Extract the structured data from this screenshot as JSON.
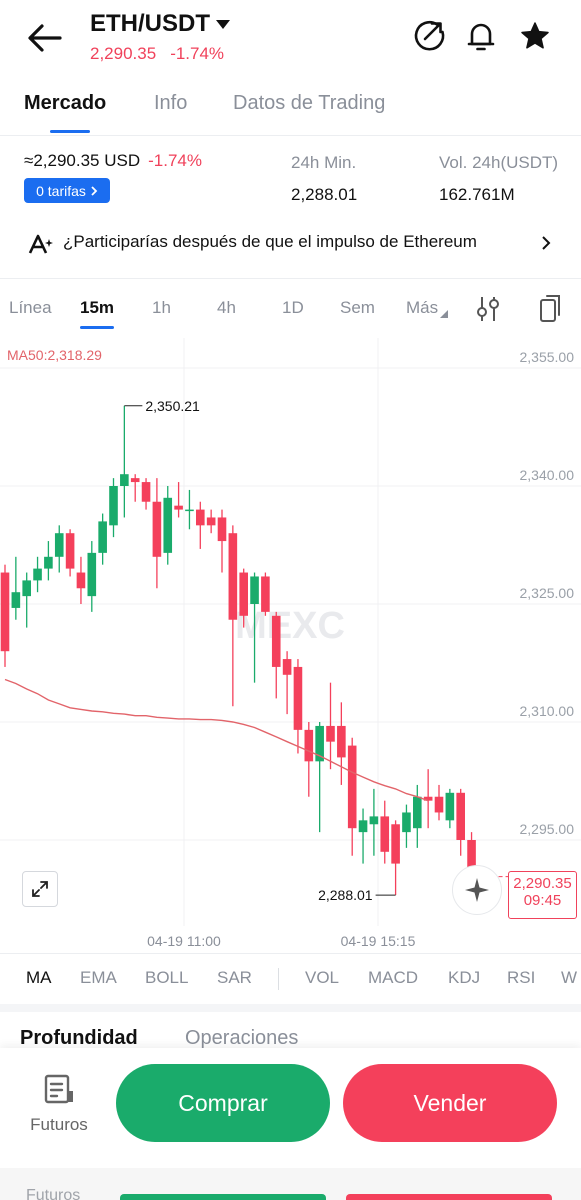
{
  "header": {
    "pair": "ETH/USDT",
    "price": "2,290.35",
    "change": "-1.74%"
  },
  "tabs": [
    {
      "label": "Mercado",
      "active": true
    },
    {
      "label": "Info",
      "active": false
    },
    {
      "label": "Datos de Trading",
      "active": false
    }
  ],
  "stats": {
    "approx_price": "≈2,290.35 USD",
    "change": "-1.74%",
    "fee_label": "0 tarifas",
    "low_label": "24h Min.",
    "low_value": "2,288.01",
    "vol_label": "Vol. 24h(USDT)",
    "vol_value": "162.761M"
  },
  "news": {
    "text": "¿Participarías después de que el impulso de Ethereum"
  },
  "intervals": [
    {
      "label": "Línea",
      "active": false
    },
    {
      "label": "15m",
      "active": true
    },
    {
      "label": "1h",
      "active": false
    },
    {
      "label": "4h",
      "active": false
    },
    {
      "label": "1D",
      "active": false
    },
    {
      "label": "Sem",
      "active": false
    },
    {
      "label": "Más",
      "active": false
    }
  ],
  "chart_data": {
    "type": "candlestick",
    "ma_label": "MA50:2,318.29",
    "y_ticks": [
      "2,355.00",
      "2,340.00",
      "2,325.00",
      "2,310.00",
      "2,295.00"
    ],
    "y_tick_values": [
      2355,
      2340,
      2325,
      2310,
      2295
    ],
    "x_ticks": [
      "04-19 11:00",
      "04-19 15:15"
    ],
    "high_label": "2,350.21",
    "low_label": "2,288.01",
    "last_price": "2,290.35",
    "countdown": "09:45",
    "watermark": "MEXC",
    "colors": {
      "up": "#1aab6b",
      "down": "#f4405b",
      "ma": "#e2646a"
    },
    "candles": [
      {
        "o": 2329.0,
        "h": 2330.0,
        "l": 2317.0,
        "c": 2319.0
      },
      {
        "o": 2324.5,
        "h": 2331.0,
        "l": 2323.0,
        "c": 2326.5
      },
      {
        "o": 2326.0,
        "h": 2329.0,
        "l": 2322.0,
        "c": 2328.0
      },
      {
        "o": 2328.0,
        "h": 2331.0,
        "l": 2326.5,
        "c": 2329.5
      },
      {
        "o": 2329.5,
        "h": 2333.0,
        "l": 2328.0,
        "c": 2331.0
      },
      {
        "o": 2331.0,
        "h": 2335.0,
        "l": 2329.0,
        "c": 2334.0
      },
      {
        "o": 2334.0,
        "h": 2334.5,
        "l": 2328.5,
        "c": 2329.5
      },
      {
        "o": 2329.0,
        "h": 2331.0,
        "l": 2325.0,
        "c": 2327.0
      },
      {
        "o": 2326.0,
        "h": 2333.0,
        "l": 2324.0,
        "c": 2331.5
      },
      {
        "o": 2331.5,
        "h": 2336.5,
        "l": 2330.0,
        "c": 2335.5
      },
      {
        "o": 2335.0,
        "h": 2341.0,
        "l": 2333.5,
        "c": 2340.0
      },
      {
        "o": 2340.0,
        "h": 2350.2,
        "l": 2336.0,
        "c": 2341.5
      },
      {
        "o": 2341.0,
        "h": 2341.5,
        "l": 2338.0,
        "c": 2340.5
      },
      {
        "o": 2340.5,
        "h": 2341.0,
        "l": 2337.0,
        "c": 2338.0
      },
      {
        "o": 2338.0,
        "h": 2341.0,
        "l": 2327.0,
        "c": 2331.0
      },
      {
        "o": 2331.5,
        "h": 2340.0,
        "l": 2330.0,
        "c": 2338.5
      },
      {
        "o": 2337.5,
        "h": 2340.5,
        "l": 2336.0,
        "c": 2337.0
      },
      {
        "o": 2337.0,
        "h": 2339.5,
        "l": 2334.5,
        "c": 2337.0
      },
      {
        "o": 2337.0,
        "h": 2338.0,
        "l": 2332.0,
        "c": 2335.0
      },
      {
        "o": 2336.0,
        "h": 2337.0,
        "l": 2334.0,
        "c": 2335.0
      },
      {
        "o": 2336.0,
        "h": 2337.0,
        "l": 2329.0,
        "c": 2333.0
      },
      {
        "o": 2334.0,
        "h": 2335.0,
        "l": 2312.0,
        "c": 2323.0
      },
      {
        "o": 2329.0,
        "h": 2329.5,
        "l": 2322.0,
        "c": 2323.5
      },
      {
        "o": 2325.0,
        "h": 2329.0,
        "l": 2315.0,
        "c": 2328.5
      },
      {
        "o": 2328.5,
        "h": 2329.0,
        "l": 2323.5,
        "c": 2324.0
      },
      {
        "o": 2323.5,
        "h": 2324.0,
        "l": 2313.0,
        "c": 2317.0
      },
      {
        "o": 2318.0,
        "h": 2319.0,
        "l": 2311.0,
        "c": 2316.0
      },
      {
        "o": 2317.0,
        "h": 2318.0,
        "l": 2306.0,
        "c": 2309.0
      },
      {
        "o": 2309.0,
        "h": 2310.0,
        "l": 2300.5,
        "c": 2305.0
      },
      {
        "o": 2305.0,
        "h": 2310.0,
        "l": 2296.0,
        "c": 2309.5
      },
      {
        "o": 2309.5,
        "h": 2315.0,
        "l": 2304.0,
        "c": 2307.5
      },
      {
        "o": 2309.5,
        "h": 2312.5,
        "l": 2302.0,
        "c": 2305.5
      },
      {
        "o": 2307.0,
        "h": 2308.0,
        "l": 2293.0,
        "c": 2296.5
      },
      {
        "o": 2296.0,
        "h": 2299.0,
        "l": 2292.0,
        "c": 2297.5
      },
      {
        "o": 2297.0,
        "h": 2301.5,
        "l": 2293.0,
        "c": 2298.0
      },
      {
        "o": 2298.0,
        "h": 2300.0,
        "l": 2292.0,
        "c": 2293.5
      },
      {
        "o": 2297.0,
        "h": 2297.5,
        "l": 2288.0,
        "c": 2292.0
      },
      {
        "o": 2296.0,
        "h": 2299.5,
        "l": 2294.0,
        "c": 2298.5
      },
      {
        "o": 2296.5,
        "h": 2302.0,
        "l": 2294.0,
        "c": 2300.5
      },
      {
        "o": 2300.5,
        "h": 2304.0,
        "l": 2296.5,
        "c": 2300.0
      },
      {
        "o": 2300.5,
        "h": 2302.0,
        "l": 2297.5,
        "c": 2298.5
      },
      {
        "o": 2297.5,
        "h": 2301.5,
        "l": 2296.5,
        "c": 2301.0
      },
      {
        "o": 2301.0,
        "h": 2301.5,
        "l": 2293.0,
        "c": 2295.0
      },
      {
        "o": 2295.0,
        "h": 2296.0,
        "l": 2290.0,
        "c": 2290.35
      }
    ],
    "ma50": [
      2315.4,
      2314.9,
      2314.2,
      2313.6,
      2312.8,
      2312.3,
      2311.8,
      2311.6,
      2311.4,
      2311.3,
      2311.1,
      2311.0,
      2310.8,
      2310.8,
      2310.6,
      2310.5,
      2310.4,
      2310.4,
      2310.3,
      2310.3,
      2310.2,
      2310.0,
      2309.7,
      2309.3,
      2308.7,
      2308.1,
      2307.5,
      2306.9,
      2306.3,
      2305.7,
      2305.0,
      2304.3,
      2303.6,
      2303.0,
      2302.4,
      2301.9,
      2301.5,
      2300.9,
      2300.5,
      2300.0
    ]
  },
  "indicators": [
    {
      "label": "MA",
      "active": true
    },
    {
      "label": "EMA",
      "active": false
    },
    {
      "label": "BOLL",
      "active": false
    },
    {
      "label": "SAR",
      "active": false
    },
    {
      "label": "VOL",
      "active": false
    },
    {
      "label": "MACD",
      "active": false
    },
    {
      "label": "KDJ",
      "active": false
    },
    {
      "label": "RSI",
      "active": false
    },
    {
      "label": "W",
      "active": false
    }
  ],
  "lower_tabs": [
    {
      "label": "Profundidad",
      "active": true
    },
    {
      "label": "Operaciones",
      "active": false
    }
  ],
  "bottom": {
    "futures_label": "Futuros",
    "buy_label": "Comprar",
    "sell_label": "Vender"
  }
}
